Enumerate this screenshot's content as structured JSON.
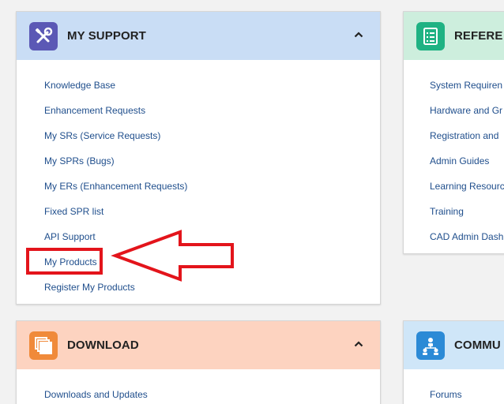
{
  "cards": {
    "my_support": {
      "title": "MY SUPPORT",
      "links": [
        "Knowledge Base",
        "Enhancement Requests",
        "My SRs (Service Requests)",
        "My SPRs (Bugs)",
        "My ERs (Enhancement Requests)",
        "Fixed SPR list",
        "API Support",
        "My Products",
        "Register My Products"
      ]
    },
    "reference": {
      "title": "REFERE",
      "links": [
        "System Requiren",
        "Hardware and Gr",
        "Registration and",
        "Admin Guides",
        "Learning Resourc",
        "Training",
        "CAD Admin Dash"
      ]
    },
    "download": {
      "title": "DOWNLOAD",
      "links": [
        "Downloads and Updates"
      ]
    },
    "community": {
      "title": "COMMU",
      "links": [
        "Forums"
      ]
    }
  },
  "icons": {
    "my_support": "tools-icon",
    "reference": "checklist-icon",
    "download": "stacked-windows-icon",
    "community": "people-network-icon",
    "collapse": "chevron-up-icon"
  },
  "colors": {
    "my_support_header": "#c9ddf5",
    "my_support_icon": "#5b58b5",
    "reference_header": "#cdeedd",
    "reference_icon": "#1fb283",
    "download_header": "#fdd3c0",
    "download_icon": "#f08a3a",
    "community_header": "#cfe6f8",
    "community_icon": "#2b8ad6",
    "link": "#1f4e8c",
    "highlight": "#e3141b"
  }
}
